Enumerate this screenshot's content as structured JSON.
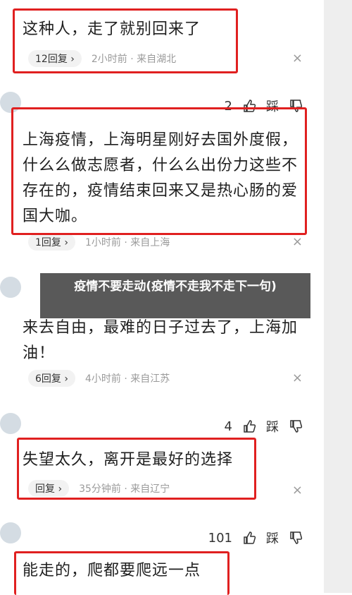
{
  "caption": "疫情不要走动(疫情不走我不走下一句)",
  "comments": [
    {
      "text": "这种人，走了就别回来了",
      "reply": "12回复 ›",
      "meta": "2小时前 · 来自湖北"
    },
    {
      "likes": "2",
      "dislike_label": "踩",
      "text": "上海疫情，上海明星刚好去国外度假，什么么做志愿者，什么么出份力这些不存在的，疫情结束回来又是热心肠的爱国大咖。",
      "reply": "1回复 ›",
      "meta": "1小时前 · 来自上海"
    },
    {
      "text": "来去自由，最难的日子过去了，上海加油！",
      "reply": "6回复 ›",
      "meta": "4小时前 · 来自江苏"
    },
    {
      "likes": "4",
      "dislike_label": "踩",
      "text": "失望太久，离开是最好的选择",
      "reply": "回复 ›",
      "meta": "35分钟前 · 来自辽宁"
    },
    {
      "likes": "101",
      "dislike_label": "踩",
      "text": "能走的，爬都要爬远一点"
    }
  ],
  "close_glyph": "×",
  "colors": {
    "highlight": "#e02020",
    "caption_bg": "#3c3c3c"
  },
  "icons": [
    "like-icon",
    "dislike-icon",
    "close-icon"
  ]
}
